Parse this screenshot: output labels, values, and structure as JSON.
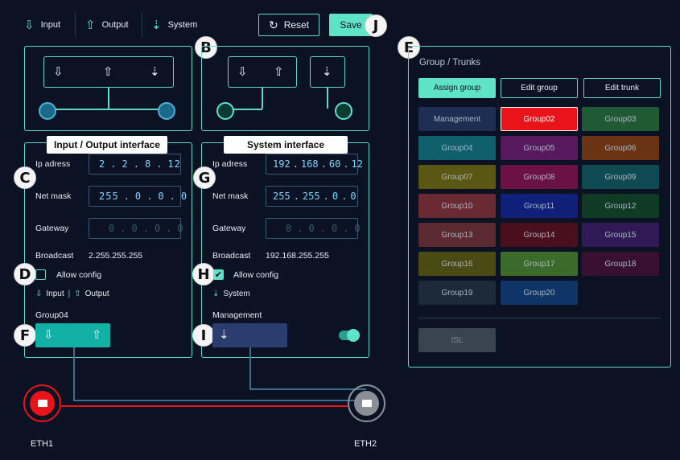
{
  "top_tabs": {
    "input": "Input",
    "output": "Output",
    "system": "System"
  },
  "toolbar": {
    "reset_label": "Reset",
    "save_label": "Save"
  },
  "badges": {
    "a_b": "B",
    "c": "C",
    "d": "D",
    "e": "E",
    "f": "F",
    "g": "G",
    "h": "H",
    "i": "I",
    "j": "J"
  },
  "io_panel": {
    "title": "Input / Output interface",
    "ip_label": "Ip adress",
    "ip": [
      "2",
      "2",
      "8",
      "12"
    ],
    "mask_label": "Net mask",
    "mask": [
      "255",
      "0",
      "0",
      "0"
    ],
    "gw_label": "Gateway",
    "gw": [
      "0",
      "0",
      "0",
      "0"
    ],
    "bc_label": "Broadcast",
    "broadcast": "2.255.255.255",
    "allow_label": "Allow config",
    "allow_checked": false,
    "type_input": "Input",
    "type_output": "Output",
    "group_label": "Group04"
  },
  "sys_panel": {
    "title": "System interface",
    "ip_label": "Ip adress",
    "ip": [
      "192",
      "168",
      "60",
      "12"
    ],
    "mask_label": "Net mask",
    "mask": [
      "255",
      "255",
      "0",
      "0"
    ],
    "gw_label": "Gateway",
    "gw": [
      "0",
      "0",
      "0",
      "0"
    ],
    "bc_label": "Broadcast",
    "broadcast": "192.168.255.255",
    "allow_label": "Allow config",
    "allow_checked": true,
    "type_system": "System",
    "group_label": "Management",
    "toggle_on": true
  },
  "ports": {
    "eth1": "ETH1",
    "eth2": "ETH2"
  },
  "groups_panel": {
    "title": "Group / Trunks",
    "assign_label": "Assign group",
    "edit_group_label": "Edit group",
    "edit_trunk_label": "Edit trunk",
    "groups": [
      {
        "name": "Management",
        "color": "#1e2d52"
      },
      {
        "name": "Group02",
        "color": "#e8141a"
      },
      {
        "name": "Group03",
        "color": "#1f5a35"
      },
      {
        "name": "Group04",
        "color": "#0f5f6c"
      },
      {
        "name": "Group05",
        "color": "#56195e"
      },
      {
        "name": "Group06",
        "color": "#6a3414"
      },
      {
        "name": "Group07",
        "color": "#5a5714"
      },
      {
        "name": "Group08",
        "color": "#6a1245"
      },
      {
        "name": "Group09",
        "color": "#0f4a52"
      },
      {
        "name": "Group10",
        "color": "#6a2a33"
      },
      {
        "name": "Group11",
        "color": "#10207a"
      },
      {
        "name": "Group12",
        "color": "#0f3a24"
      },
      {
        "name": "Group13",
        "color": "#5a2a30"
      },
      {
        "name": "Group14",
        "color": "#4a0f1c"
      },
      {
        "name": "Group15",
        "color": "#2f1a55"
      },
      {
        "name": "Group16",
        "color": "#4a4a14"
      },
      {
        "name": "Group17",
        "color": "#3c6a2a"
      },
      {
        "name": "Group18",
        "color": "#3a1030"
      },
      {
        "name": "Group19",
        "color": "#1c2a3a"
      },
      {
        "name": "Group20",
        "color": "#0f3566"
      }
    ],
    "isl_label": "ISL"
  },
  "colors": {
    "accent": "#63d8c6",
    "eth1": "#e8141a",
    "eth2": "#8a8f96",
    "bg": "#0a1224"
  }
}
